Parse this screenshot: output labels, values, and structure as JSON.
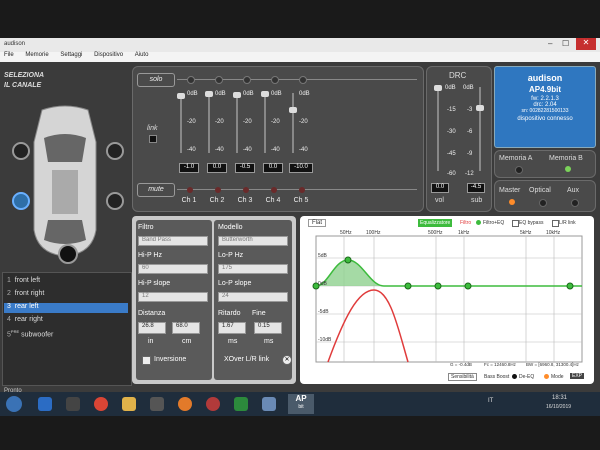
{
  "window": {
    "title": "audison",
    "menu": [
      "File",
      "Memorie",
      "Settaggi",
      "Dispositivo",
      "Aiuto"
    ]
  },
  "left": {
    "title_line1": "SELEZIONA",
    "title_line2": "IL CANALE",
    "channels": [
      {
        "num": "1",
        "name": "front left"
      },
      {
        "num": "2",
        "name": "front right"
      },
      {
        "num": "3",
        "name": "rear left"
      },
      {
        "num": "4",
        "name": "rear right"
      },
      {
        "num": "5",
        "pre": "PRE",
        "name": "subwoofer"
      }
    ],
    "status": "Pronto"
  },
  "mixer": {
    "solo_label": "solo",
    "link_label": "link",
    "mute_label": "mute",
    "db_labels": [
      "0dB",
      "-20",
      "-40"
    ],
    "faders": [
      {
        "name": "Ch 1",
        "value": "-1.0"
      },
      {
        "name": "Ch 2",
        "value": "0.0"
      },
      {
        "name": "Ch 3",
        "value": "-0.5"
      },
      {
        "name": "Ch 4",
        "value": "0.0"
      },
      {
        "name": "Ch 5",
        "value": "-10.0"
      }
    ]
  },
  "drc": {
    "title": "DRC",
    "left_scale": [
      "0dB",
      "-15",
      "-30",
      "-45",
      "-60"
    ],
    "right_scale": [
      "0dB",
      "-3",
      "-6",
      "-9",
      "-12"
    ],
    "vol_value": "0.0",
    "sub_value": "-4.5",
    "vol_label": "vol",
    "sub_label": "sub"
  },
  "device": {
    "brand": "audison",
    "model": "AP4.9bit",
    "fw": "fw: 2.2.1.3",
    "drc": "drc: 2.04",
    "sn": "sn: 00282281500133",
    "status": "dispositivo connesso"
  },
  "memory": {
    "a": "Memoria A",
    "b": "Memoria B"
  },
  "source": {
    "master": "Master",
    "optical": "Optical",
    "aux": "Aux"
  },
  "filter": {
    "filtro_label": "Filtro",
    "filtro_value": "Band Pass",
    "modello_label": "Modello",
    "modello_value": "Butterworth",
    "hp_hz_label": "Hi-P Hz",
    "hp_hz_value": "60",
    "lp_hz_label": "Lo-P Hz",
    "lp_hz_value": "175",
    "hp_slope_label": "Hi-P slope",
    "hp_slope_value": "12",
    "lp_slope_label": "Lo-P slope",
    "lp_slope_value": "24",
    "distanza_label": "Distanza",
    "ritardo_label": "Ritardo",
    "fine_label": "Fine",
    "dist_in": "26.8",
    "dist_cm": "68.0",
    "ritardo": "1.67",
    "fine": "0.15",
    "unit_in": "in",
    "unit_cm": "cm",
    "unit_ms1": "ms",
    "unit_ms2": "ms",
    "inversione": "Inversione",
    "xover_link": "XOver L/R link"
  },
  "eq": {
    "flat": "Flat",
    "equalizzatore": "Equalizzatore",
    "filtro_tag": "Filtro",
    "filtro_eq": "Filtro+EQ",
    "eq_bypass": "EQ bypass",
    "lr_link": "L/R link",
    "freq_labels": [
      "50Hz",
      "100Hz",
      "500Hz",
      "1kHz",
      "5kHz",
      "10kHz"
    ],
    "db_labels": [
      "5dB",
      "0dB",
      "-5dB",
      "-10dB"
    ],
    "readout_g": "G = -0.4dB",
    "readout_fc": "Fc = 12460.8Hz",
    "readout_bw": "BW = [6960.8, 31300.4]Hz",
    "sensibilita": "Sensibilità",
    "bass_boost": "Bass Boost",
    "de_eq": "De-EQ",
    "mode": "Mode",
    "exp": "EXP"
  },
  "taskbar": {
    "app_label_1": "AP",
    "app_label_2": "bit",
    "lang": "IT",
    "time": "18:31",
    "date": "16/10/2019"
  }
}
